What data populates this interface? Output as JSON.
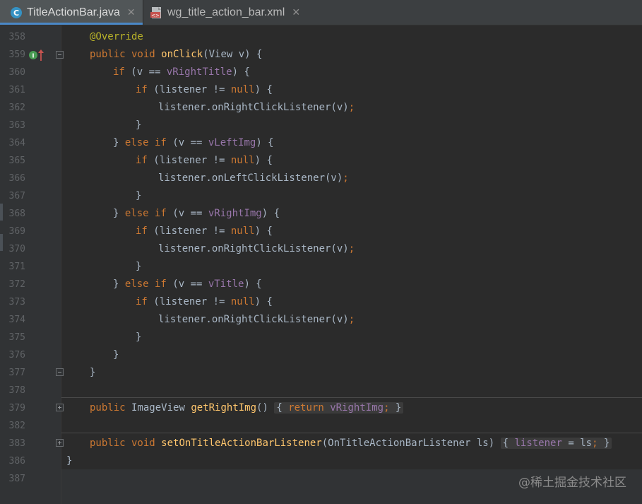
{
  "tabs": [
    {
      "label": "TitleActionBar.java",
      "icon": "java-class-icon",
      "active": true
    },
    {
      "label": "wg_title_action_bar.xml",
      "icon": "xml-layout-icon",
      "active": false
    }
  ],
  "line_numbers": [
    "358",
    "359",
    "360",
    "361",
    "362",
    "363",
    "364",
    "365",
    "366",
    "367",
    "368",
    "369",
    "370",
    "371",
    "372",
    "373",
    "374",
    "375",
    "376",
    "377",
    "378",
    "379",
    "382",
    "383",
    "386",
    "387"
  ],
  "code": {
    "l358": {
      "ann": "@Override"
    },
    "l359": {
      "kw": "public void ",
      "fn": "onClick",
      "rest": "(View v) {"
    },
    "l360": {
      "kw": "if ",
      "a": "(v == ",
      "fld": "vRightTitle",
      "b": ") {"
    },
    "l361": {
      "kw": "if ",
      "a": "(listener != ",
      "kw2": "null",
      "b": ") {"
    },
    "l362": {
      "a": "listener.onRightClickListener(v)",
      "semi": ";"
    },
    "l363": {
      "a": "}"
    },
    "l364": {
      "a": "} ",
      "kw": "else if ",
      "b": "(v == ",
      "fld": "vLeftImg",
      "c": ") {"
    },
    "l365": {
      "kw": "if ",
      "a": "(listener != ",
      "kw2": "null",
      "b": ") {"
    },
    "l366": {
      "a": "listener.onLeftClickListener(v)",
      "semi": ";"
    },
    "l367": {
      "a": "}"
    },
    "l368": {
      "a": "} ",
      "kw": "else if ",
      "b": "(v == ",
      "fld": "vRightImg",
      "c": ") {"
    },
    "l369": {
      "kw": "if ",
      "a": "(listener != ",
      "kw2": "null",
      "b": ") {"
    },
    "l370": {
      "a": "listener.onRightClickListener(v)",
      "semi": ";"
    },
    "l371": {
      "a": "}"
    },
    "l372": {
      "a": "} ",
      "kw": "else if ",
      "b": "(v == ",
      "fld": "vTitle",
      "c": ") {"
    },
    "l373": {
      "kw": "if ",
      "a": "(listener != ",
      "kw2": "null",
      "b": ") {"
    },
    "l374": {
      "a": "listener.onRightClickListener(v)",
      "semi": ";"
    },
    "l375": {
      "a": "}"
    },
    "l376": {
      "a": "}"
    },
    "l377": {
      "a": "}"
    },
    "l379": {
      "kw": "public ",
      "a": "ImageView ",
      "fn": "getRightImg",
      "b": "() ",
      "fold_open": "{ ",
      "kw2": "return ",
      "fld": "vRightImg",
      "semi": ";",
      "fold_close": " }"
    },
    "l383": {
      "kw": "public void ",
      "fn": "setOnTitleActionBarListener",
      "a": "(OnTitleActionBarListener ls) ",
      "fold_open": "{ ",
      "fld": "listener",
      "b": " = ls",
      "semi": ";",
      "fold_close": " }"
    },
    "l386": {
      "a": "}"
    }
  },
  "watermark": "@稀土掘金技术社区",
  "colors": {
    "background": "#2b2b2b",
    "gutter": "#313335",
    "keyword": "#cc7832",
    "function": "#ffc66d",
    "field": "#9876aa",
    "annotation": "#bbb529",
    "text": "#a9b7c6",
    "line_number": "#606366"
  }
}
